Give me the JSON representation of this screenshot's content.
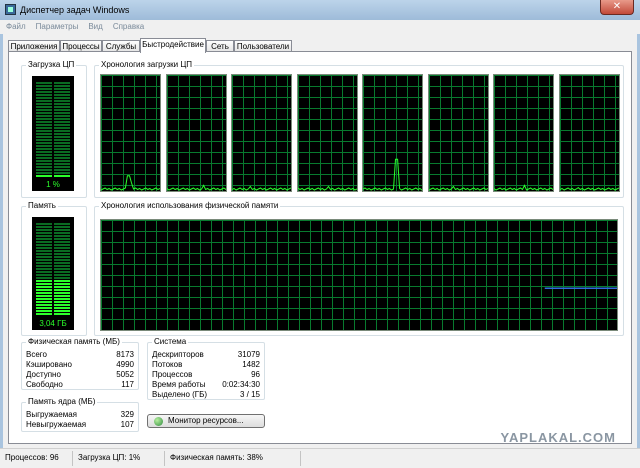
{
  "window": {
    "title": "Диспетчер задач Windows",
    "close_glyph": "✕"
  },
  "menu": [
    "Файл",
    "Параметры",
    "Вид",
    "Справка"
  ],
  "tabs": [
    "Приложения",
    "Процессы",
    "Службы",
    "Быстродействие",
    "Сеть",
    "Пользователи"
  ],
  "active_tab": "Быстродействие",
  "cpu": {
    "group_label": "Загрузка ЦП",
    "value_text": "1 %",
    "level": 0.01
  },
  "cpu_history": {
    "group_label": "Хронология загрузки ЦП",
    "cores": 8
  },
  "memory": {
    "group_label": "Память",
    "value_text": "3,04 ГБ",
    "level": 0.38
  },
  "memory_history": {
    "group_label": "Хронология использования физической памяти",
    "level": 0.38
  },
  "physical_memory": {
    "group_label": "Физическая память (МБ)",
    "rows": [
      {
        "label": "Всего",
        "value": "8173"
      },
      {
        "label": "Кэшировано",
        "value": "4990"
      },
      {
        "label": "Доступно",
        "value": "5052"
      },
      {
        "label": "Свободно",
        "value": "117"
      }
    ]
  },
  "kernel_memory": {
    "group_label": "Память ядра (МБ)",
    "rows": [
      {
        "label": "Выгружаемая",
        "value": "329"
      },
      {
        "label": "Невыгружаемая",
        "value": "107"
      }
    ]
  },
  "system": {
    "group_label": "Система",
    "rows": [
      {
        "label": "Дескрипторов",
        "value": "31079"
      },
      {
        "label": "Потоков",
        "value": "1482"
      },
      {
        "label": "Процессов",
        "value": "96"
      },
      {
        "label": "Время работы",
        "value": "0:02:34:30"
      },
      {
        "label": "Выделено (ГБ)",
        "value": "3 / 15"
      }
    ]
  },
  "resource_monitor_button": "Монитор ресурсов...",
  "status": {
    "processes": "Процессов: 96",
    "cpu": "Загрузка ЦП: 1%",
    "memory": "Физическая память: 38%"
  },
  "watermark": "YAPLAKAL.COM",
  "colors": {
    "graph_bg": "#000000",
    "grid": "#087a2e",
    "trace": "#2bff2b",
    "memory_line": "#2f6bdb"
  }
}
